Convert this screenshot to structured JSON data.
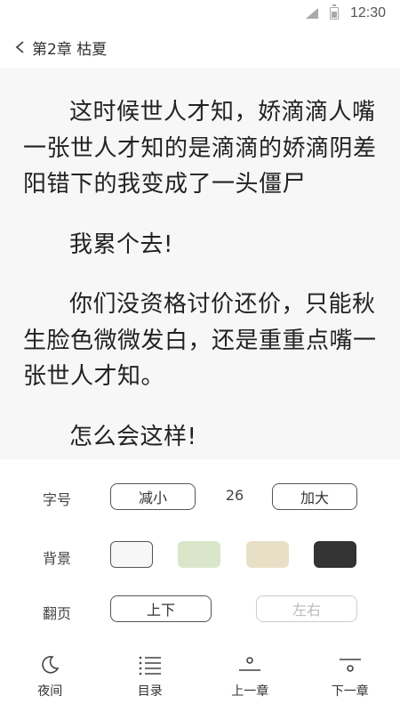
{
  "status_bar": {
    "time": "12:30"
  },
  "header": {
    "title": "第2章 枯夏"
  },
  "content": {
    "paragraphs": [
      "这时候世人才知，娇滴滴人嘴一张世人才知的是滴滴的娇滴阴差阳错下的我变成了一头僵尸",
      "我累个去!",
      "你们没资格讨价还价，只能秋生脸色微微发白，还是重重点嘴一张世人才知。",
      "怎么会这样!"
    ]
  },
  "settings": {
    "font_size": {
      "label": "字号",
      "decrease": "减小",
      "value": "26",
      "increase": "加大"
    },
    "background": {
      "label": "背景",
      "colors": [
        "#f7f7f7",
        "#d9e6c9",
        "#e8e0c6",
        "#333333"
      ]
    },
    "page_turn": {
      "label": "翻页",
      "option_vertical": "上下",
      "option_horizontal": "左右"
    }
  },
  "bottom_bar": {
    "night": "夜间",
    "toc": "目录",
    "prev_chapter": "上一章",
    "next_chapter": "下一章"
  }
}
